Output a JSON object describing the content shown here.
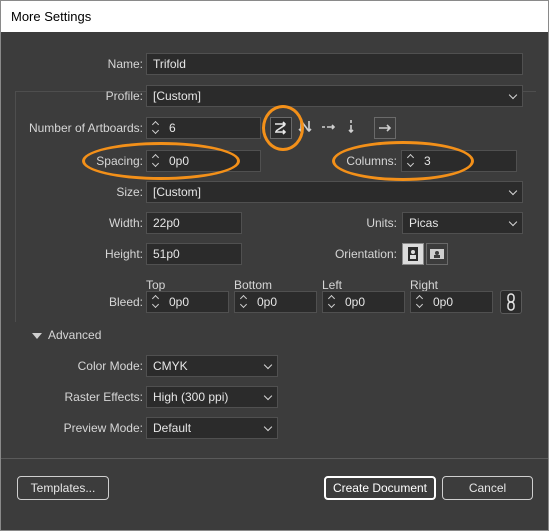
{
  "window": {
    "title": "More Settings"
  },
  "form": {
    "name_label": "Name:",
    "name_value": "Trifold",
    "profile_label": "Profile:",
    "profile_value": "[Custom]",
    "artboards_label": "Number of Artboards:",
    "artboards_value": "6",
    "spacing_label": "Spacing:",
    "spacing_value": "0p0",
    "columns_label": "Columns:",
    "columns_value": "3",
    "size_label": "Size:",
    "size_value": "[Custom]",
    "width_label": "Width:",
    "width_value": "22p0",
    "units_label": "Units:",
    "units_value": "Picas",
    "height_label": "Height:",
    "height_value": "51p0",
    "orientation_label": "Orientation:",
    "bleed_label": "Bleed:",
    "bleed_top_label": "Top",
    "bleed_top_value": "0p0",
    "bleed_bottom_label": "Bottom",
    "bleed_bottom_value": "0p0",
    "bleed_left_label": "Left",
    "bleed_left_value": "0p0",
    "bleed_right_label": "Right",
    "bleed_right_value": "0p0",
    "advanced_label": "Advanced",
    "color_mode_label": "Color Mode:",
    "color_mode_value": "CMYK",
    "raster_label": "Raster Effects:",
    "raster_value": "High (300 ppi)",
    "preview_label": "Preview Mode:",
    "preview_value": "Default"
  },
  "footer": {
    "templates_label": "Templates...",
    "create_label": "Create Document",
    "cancel_label": "Cancel"
  },
  "icons": {
    "grid_by_row": "grid-by-row-icon",
    "grid_by_column": "grid-by-column-icon",
    "arrange_by_row": "arrange-by-row-icon",
    "arrange_by_column": "arrange-by-column-icon",
    "layout_rtl": "change-to-right-to-left-icon",
    "portrait": "portrait-icon",
    "landscape": "landscape-icon",
    "link": "link-bleed-icon"
  },
  "colors": {
    "callout": "#f39019",
    "background": "#3c3c3c",
    "field": "#2b2b2b"
  }
}
